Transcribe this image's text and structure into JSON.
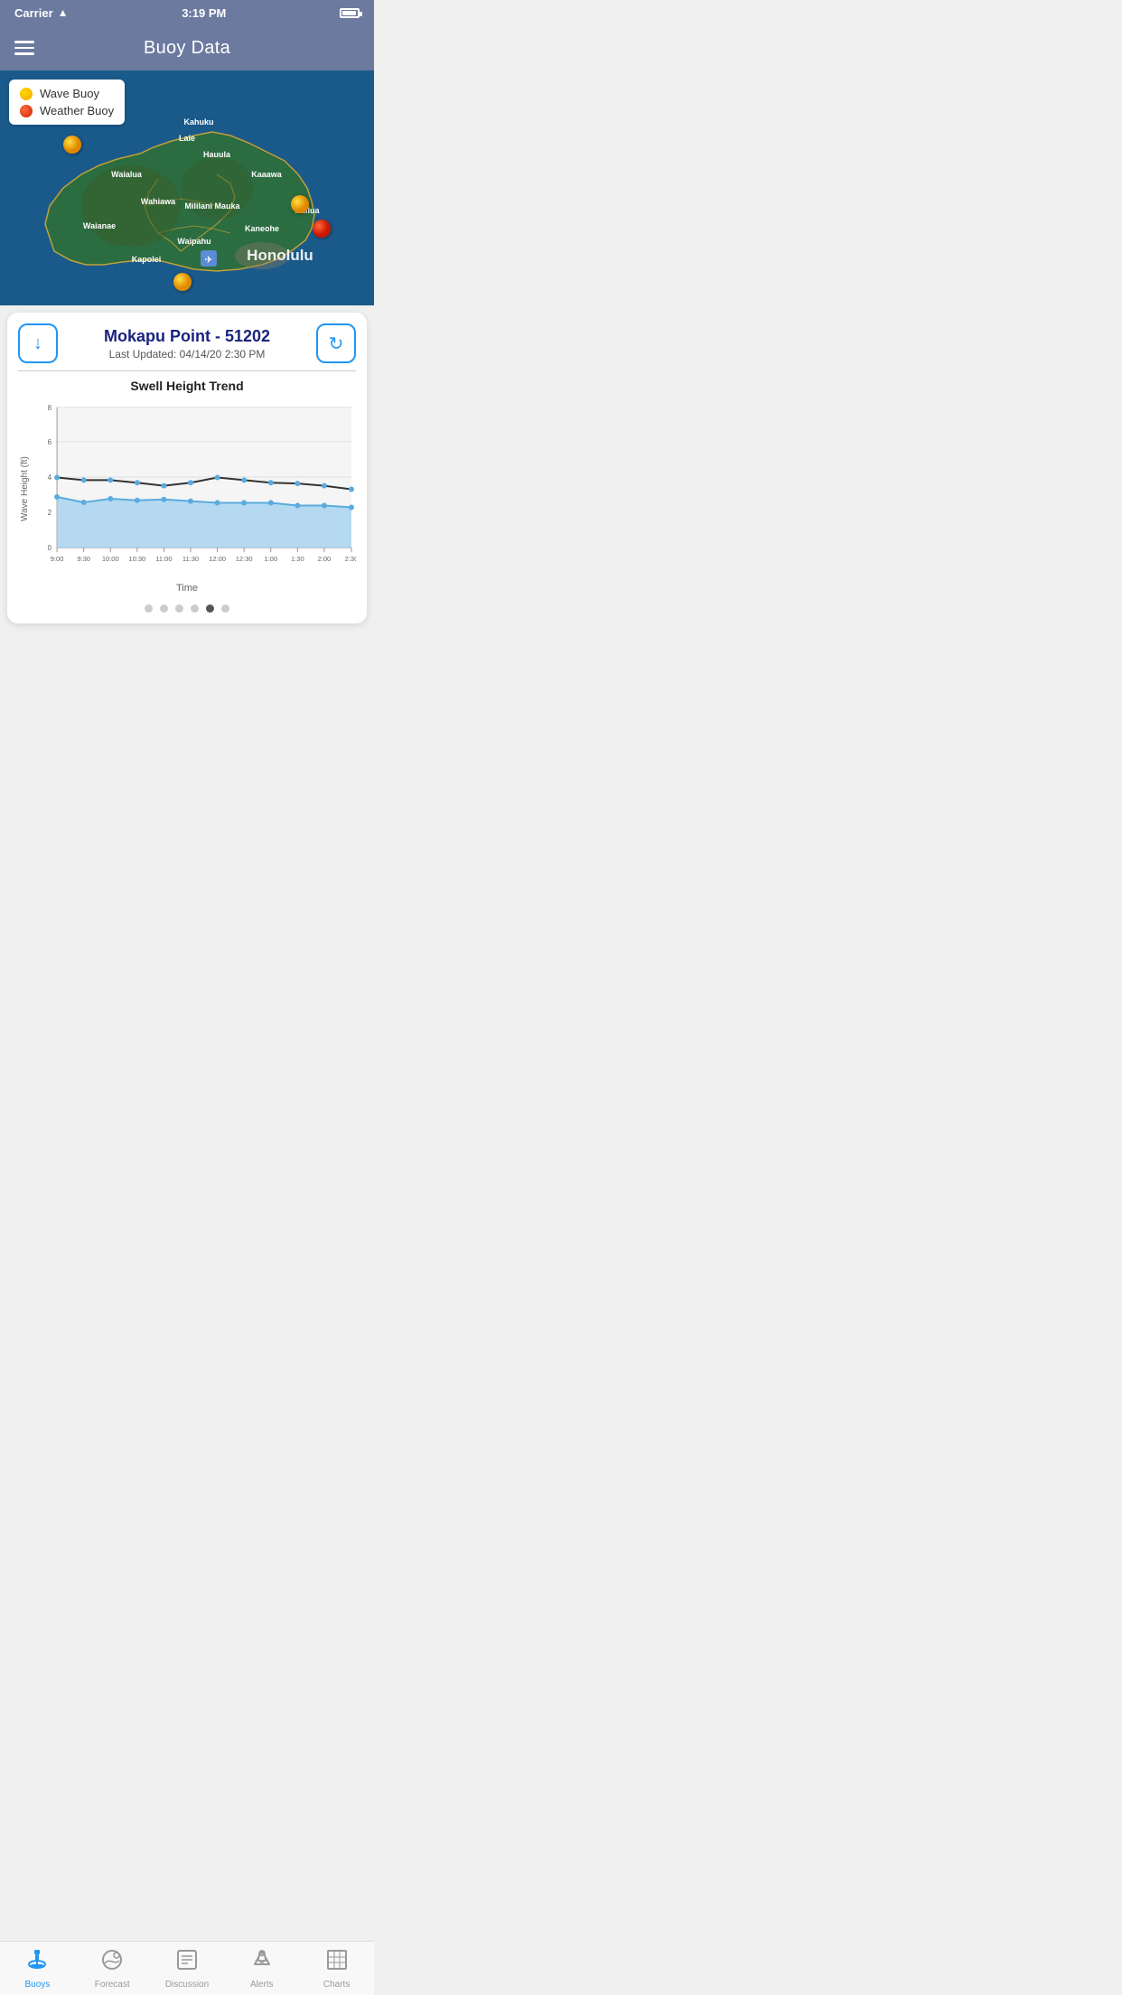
{
  "statusBar": {
    "carrier": "Carrier",
    "time": "3:19 PM"
  },
  "header": {
    "title": "Buoy Data",
    "menuLabel": "Menu"
  },
  "map": {
    "legend": {
      "waveBuoyLabel": "Wave Buoy",
      "weatherBuoyLabel": "Weather Buoy"
    }
  },
  "dataPanel": {
    "title": "Mokapu Point - 51202",
    "lastUpdated": "Last Updated: 04/14/20 2:30 PM",
    "downloadLabel": "Download",
    "refreshLabel": "Refresh",
    "chart": {
      "title": "Swell Height Trend",
      "yAxisLabel": "Wave Height (ft)",
      "xAxisLabel": "Time",
      "yMax": 8,
      "xLabels": [
        "9:00",
        "9:30",
        "10:00",
        "10:30",
        "11:00",
        "11:30",
        "12:00",
        "12:30",
        "1:00",
        "1:30",
        "2:00",
        "2:30"
      ],
      "yTicks": [
        0,
        2,
        4,
        6,
        8
      ],
      "upperLine": [
        4.1,
        3.9,
        3.9,
        3.7,
        3.5,
        3.7,
        4.0,
        3.8,
        3.7,
        3.65,
        3.5,
        3.3
      ],
      "lowerLine": [
        2.9,
        2.6,
        2.8,
        2.7,
        2.75,
        2.65,
        2.55,
        2.55,
        2.55,
        2.4,
        2.4,
        2.3
      ]
    },
    "paginationDots": 6,
    "activeDot": 4
  },
  "tabBar": {
    "items": [
      {
        "label": "Buoys",
        "icon": "buoy",
        "active": true
      },
      {
        "label": "Forecast",
        "icon": "forecast",
        "active": false
      },
      {
        "label": "Discussion",
        "icon": "discussion",
        "active": false
      },
      {
        "label": "Alerts",
        "icon": "alerts",
        "active": false
      },
      {
        "label": "Charts",
        "icon": "charts",
        "active": false
      }
    ]
  }
}
